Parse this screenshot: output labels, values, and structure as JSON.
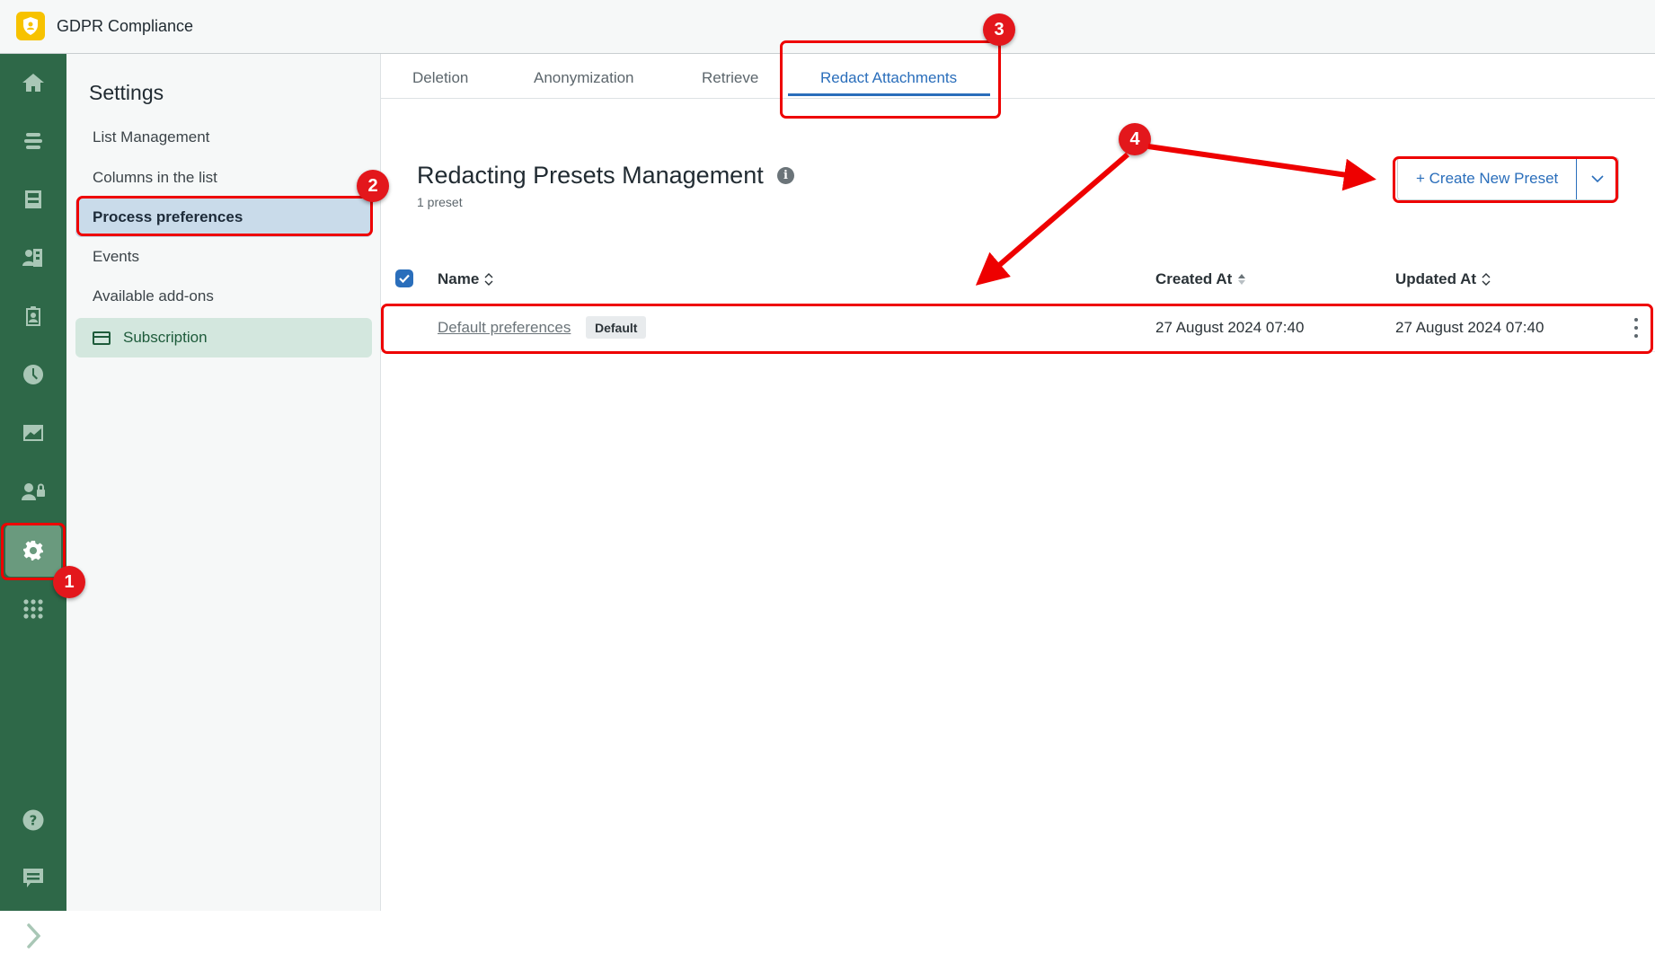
{
  "app": {
    "title": "GDPR Compliance",
    "logo_icon": "shield-user-icon"
  },
  "rail": {
    "items": [
      {
        "icon": "home-icon"
      },
      {
        "icon": "list-icon"
      },
      {
        "icon": "inbox-icon"
      },
      {
        "icon": "contacts-book-icon"
      },
      {
        "icon": "clipboard-user-icon"
      },
      {
        "icon": "clock-icon"
      },
      {
        "icon": "chart-icon"
      },
      {
        "icon": "user-lock-icon"
      },
      {
        "icon": "gear-icon",
        "active": true
      },
      {
        "icon": "apps-grid-icon"
      }
    ],
    "bottom": [
      {
        "icon": "help-icon"
      },
      {
        "icon": "chat-icon"
      },
      {
        "icon": "chevron-right-icon"
      }
    ]
  },
  "settings": {
    "title": "Settings",
    "items": [
      {
        "label": "List Management"
      },
      {
        "label": "Columns in the list"
      },
      {
        "label": "Process preferences",
        "active": true
      },
      {
        "label": "Events"
      },
      {
        "label": "Available add-ons"
      },
      {
        "label": "Subscription",
        "icon": "credit-card-icon"
      }
    ]
  },
  "tabs": [
    {
      "label": "Deletion"
    },
    {
      "label": "Anonymization"
    },
    {
      "label": "Retrieve"
    },
    {
      "label": "Redact Attachments",
      "active": true
    }
  ],
  "page": {
    "title": "Redacting Presets Management",
    "count": "1 preset",
    "create_button": "+ Create New Preset"
  },
  "table": {
    "columns": [
      {
        "label": "Name",
        "sort": "none"
      },
      {
        "label": "Created At",
        "sort": "sortable-active"
      },
      {
        "label": "Updated At",
        "sort": "none"
      }
    ],
    "rows": [
      {
        "name": "Default preferences",
        "badge": "Default",
        "created_at": "27 August 2024 07:40",
        "updated_at": "27 August 2024 07:40"
      }
    ]
  },
  "annotations": [
    {
      "number": "1"
    },
    {
      "number": "2"
    },
    {
      "number": "3"
    },
    {
      "number": "4"
    }
  ],
  "colors": {
    "rail": "#2e6848",
    "accent": "#2a6ebb",
    "annotation": "#ee0000",
    "logo": "#f7c200"
  }
}
